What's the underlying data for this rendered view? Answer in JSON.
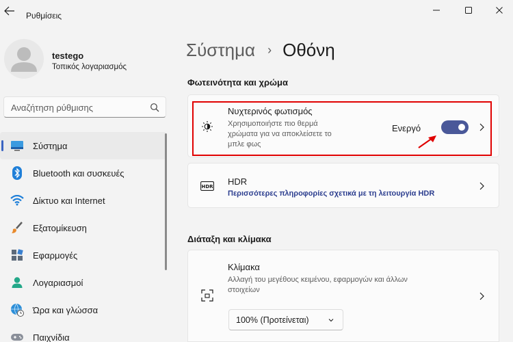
{
  "app": {
    "title": "Ρυθμίσεις"
  },
  "window_controls": [
    "minimize-icon",
    "maximize-icon",
    "close-icon"
  ],
  "profile": {
    "name": "testego",
    "account_type": "Τοπικός λογαριασμός"
  },
  "search": {
    "placeholder": "Αναζήτηση ρύθμισης"
  },
  "sidebar": {
    "items": [
      {
        "label": "Σύστημα",
        "icon": "system-monitor-icon",
        "active": true
      },
      {
        "label": "Bluetooth και συσκευές",
        "icon": "bluetooth-icon"
      },
      {
        "label": "Δίκτυο και Internet",
        "icon": "wifi-icon"
      },
      {
        "label": "Εξατομίκευση",
        "icon": "paintbrush-icon"
      },
      {
        "label": "Εφαρμογές",
        "icon": "apps-icon"
      },
      {
        "label": "Λογαριασμοί",
        "icon": "account-icon"
      },
      {
        "label": "Ώρα και γλώσσα",
        "icon": "globe-clock-icon"
      },
      {
        "label": "Παιχνίδια",
        "icon": "gamepad-icon"
      }
    ]
  },
  "breadcrumb": {
    "parent": "Σύστημα",
    "separator": "›",
    "current": "Οθόνη"
  },
  "sections": {
    "brightness": "Φωτεινότητα και χρώμα",
    "layout": "Διάταξη και κλίμακα"
  },
  "night_light": {
    "title": "Νυχτερινός φωτισμός",
    "desc_line1": "Χρησιμοποιήστε πιο θερμά",
    "desc_line2": "χρώματα για να αποκλείσετε το",
    "desc_line3": "μπλε φως",
    "status": "Ενεργό",
    "enabled": true
  },
  "hdr": {
    "title": "HDR",
    "link": "Περισσότερες πληροφορίες σχετικά με τη λειτουργία HDR"
  },
  "scale": {
    "title": "Κλίμακα",
    "desc_line1": "Αλλαγή του μεγέθους κειμένου, εφαρμογών και άλλων",
    "desc_line2": "στοιχείων",
    "value": "100% (Προτείνεται)"
  },
  "colors": {
    "accent": "#4a5899",
    "highlight": "#e00000",
    "link": "#2c3e8f"
  }
}
